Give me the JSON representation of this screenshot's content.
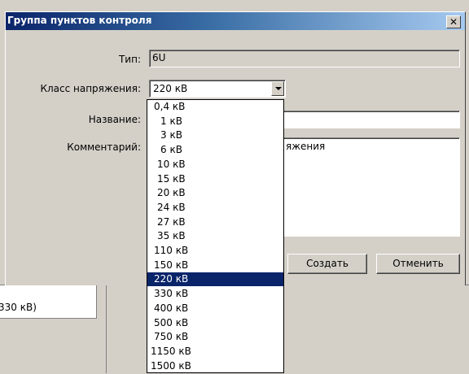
{
  "background": {
    "cell_text": "330 кВ)"
  },
  "dialog": {
    "title": "Группа пунктов контроля",
    "close_glyph": "✕",
    "type_label": "Тип:",
    "type_value": "6U",
    "voltage_label": "Класс напряжения:",
    "voltage_value": "220 кВ",
    "name_label": "Название:",
    "name_value": "",
    "comment_label": "Комментарий:",
    "comment_value": "яжения",
    "create_label": "Создать",
    "cancel_label": "Отменить"
  },
  "dropdown": {
    "selected": "220 кВ",
    "options": [
      "0,4 кВ",
      "1 кВ",
      "3 кВ",
      "6 кВ",
      "10 кВ",
      "15 кВ",
      "20 кВ",
      "24 кВ",
      "27 кВ",
      "35 кВ",
      "110 кВ",
      "150 кВ",
      "220 кВ",
      "330 кВ",
      "400 кВ",
      "500 кВ",
      "750 кВ",
      "1150 кВ",
      "1500 кВ"
    ]
  },
  "colors": {
    "selection": "#0a246a",
    "face": "#d4d0c8"
  }
}
